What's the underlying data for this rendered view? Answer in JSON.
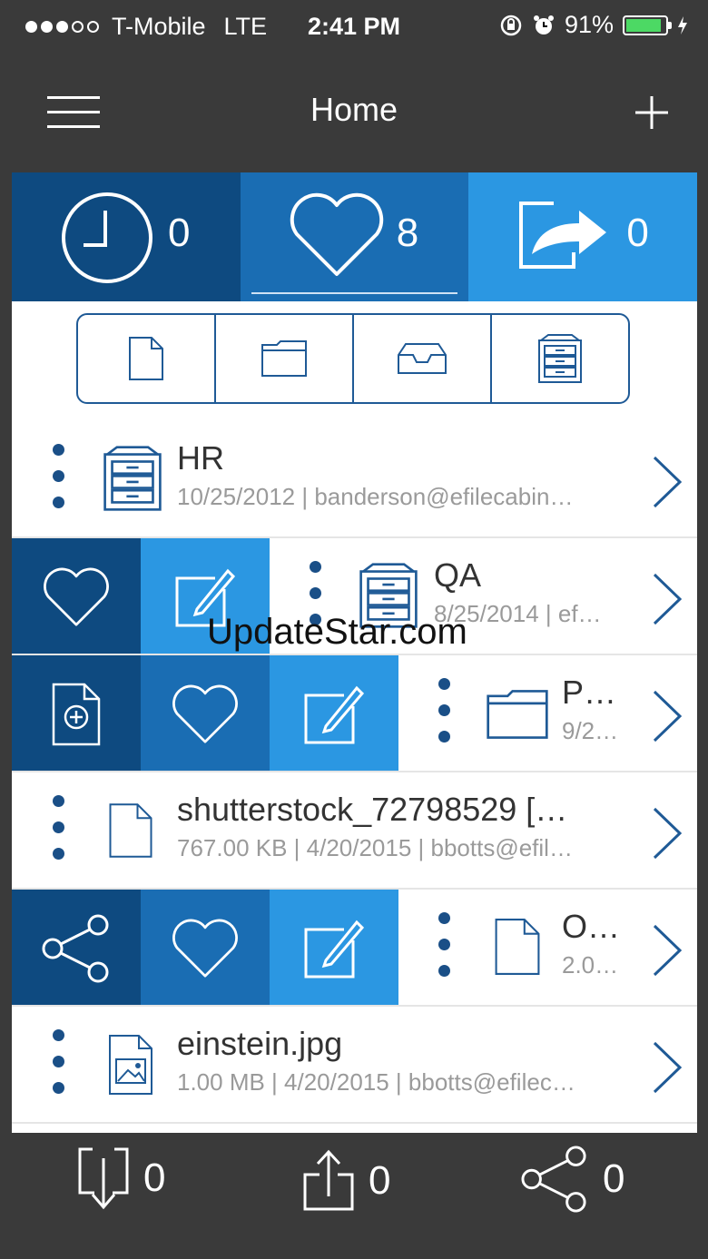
{
  "status_bar": {
    "carrier": "T-Mobile",
    "network": "LTE",
    "time": "2:41 PM",
    "battery": "91%",
    "battery_level": 0.91
  },
  "nav": {
    "title": "Home"
  },
  "tabs": [
    {
      "icon": "clock-icon",
      "count": "0"
    },
    {
      "icon": "heart-icon",
      "count": "8",
      "selected": true
    },
    {
      "icon": "share-out-icon",
      "count": "0"
    }
  ],
  "filters": [
    "document-icon",
    "folder-icon",
    "inbox-tray-icon",
    "cabinet-icon"
  ],
  "rows": [
    {
      "name": "HR",
      "meta": "10/25/2012 | banderson@efilecabin…",
      "icon": "cabinet-icon"
    },
    {
      "name": "QA",
      "meta": "8/25/2014 | ef…",
      "icon": "cabinet-icon",
      "actions": [
        "heart-icon",
        "edit-icon"
      ]
    },
    {
      "name": "P…",
      "meta": "9/2…",
      "icon": "folder-icon",
      "actions": [
        "add-file-icon",
        "heart-icon",
        "edit-icon"
      ]
    },
    {
      "name": "shutterstock_72798529 […",
      "meta": "767.00 KB | 4/20/2015 | bbotts@efil…",
      "icon": "document-icon"
    },
    {
      "name": "O…",
      "meta": "2.0…",
      "icon": "document-icon",
      "actions": [
        "share-icon",
        "heart-icon",
        "edit-icon"
      ]
    },
    {
      "name": "einstein.jpg",
      "meta": "1.00 MB | 4/20/2015 | bbotts@efilec…",
      "icon": "image-file-icon"
    }
  ],
  "bottom_bar": [
    {
      "icon": "download-icon",
      "count": "0"
    },
    {
      "icon": "upload-icon",
      "count": "0"
    },
    {
      "icon": "share-icon",
      "count": "0"
    }
  ],
  "watermark": "UpdateStar.com",
  "colors": {
    "dark_blue": "#0e4a80",
    "mid_blue": "#1a6db3",
    "light_blue": "#2b97e2",
    "icon_navy": "#1f5a96",
    "background": "#3a3a3a"
  }
}
